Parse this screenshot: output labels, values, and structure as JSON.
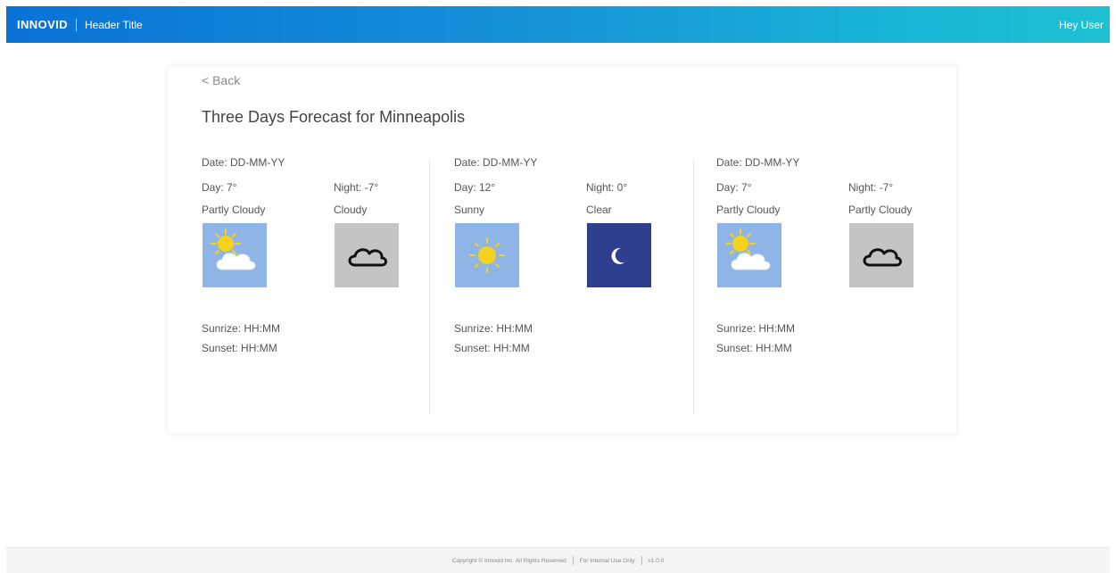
{
  "header": {
    "logo": "INNOVID",
    "title": "Header Title",
    "user": "Hey User"
  },
  "page": {
    "back_label": "< Back",
    "title": "Three Days Forecast for Minneapolis"
  },
  "days": [
    {
      "date": "Date: DD-MM-YY",
      "day_temp": "Day: 7°",
      "night_temp": "Night: -7°",
      "day_condition": "Partly Cloudy",
      "night_condition": "Cloudy",
      "day_icon": "partly-cloudy-icon",
      "night_icon": "cloud-icon",
      "sunrise": "Sunrize: HH:MM",
      "sunset": "Sunset: HH:MM"
    },
    {
      "date": "Date: DD-MM-YY",
      "day_temp": "Day: 12°",
      "night_temp": "Night: 0°",
      "day_condition": "Sunny",
      "night_condition": "Clear",
      "day_icon": "sun-icon",
      "night_icon": "moon-icon",
      "sunrise": "Sunrize: HH:MM",
      "sunset": "Sunset: HH:MM"
    },
    {
      "date": "Date: DD-MM-YY",
      "day_temp": "Day: 7°",
      "night_temp": "Night: -7°",
      "day_condition": "Partly Cloudy",
      "night_condition": "Partly Cloudy",
      "day_icon": "partly-cloudy-icon",
      "night_icon": "cloud-icon",
      "sunrise": "Sunrize: HH:MM",
      "sunset": "Sunset: HH:MM"
    }
  ],
  "colors": {
    "header_gradient_start": "#0a72d6",
    "header_gradient_end": "#1ec0d2",
    "day_icon_bg": "#8fb4e6",
    "cloudy_icon_bg": "#c4c4c4",
    "night_clear_bg": "#2f3f8f",
    "sun": "#f5d21f"
  },
  "footer": {
    "copyright": "Copyright © Innovid Inc. All Rights Reserved",
    "internal": "For Internal Use Only",
    "version": "v1.0.0"
  }
}
